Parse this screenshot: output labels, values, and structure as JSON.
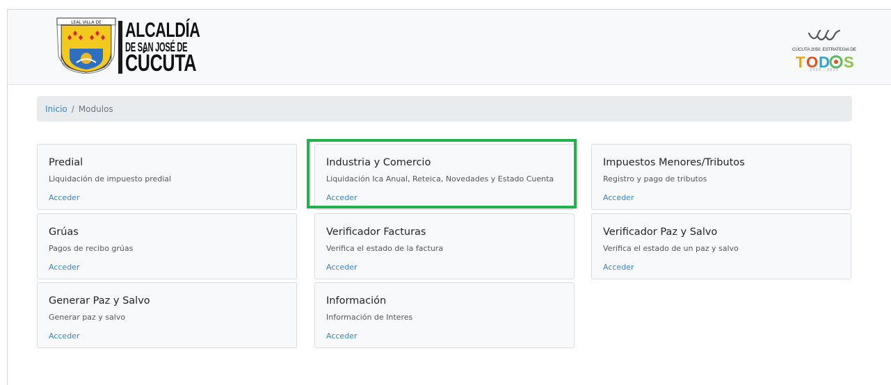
{
  "header": {
    "logo_left": {
      "line1": "ALCALDÍA",
      "line2": "DE SAN JOSÉ DE",
      "line3": "CÚCUTA",
      "shield_text": "LEAL VILLA DE SAN JOSE DE CUCUTA"
    },
    "logo_right": {
      "tagline": "CÚCUTA 2050, ESTRATEGIA DE",
      "brand": "TODOS",
      "years": "2020 - 2023"
    }
  },
  "breadcrumb": {
    "home": "Inicio",
    "separator": "/",
    "current": "Modulos"
  },
  "modules": [
    {
      "title": "Predial",
      "description": "Liquidación de impuesto predial",
      "link": "Acceder"
    },
    {
      "title": "Industria y Comercio",
      "description": "Liquidación Ica Anual, Reteica, Novedades y Estado Cuenta",
      "link": "Acceder"
    },
    {
      "title": "Impuestos Menores/Tributos",
      "description": "Registro y pago de tributos",
      "link": "Acceder"
    },
    {
      "title": "Grúas",
      "description": "Pagos de recibo grúas",
      "link": "Acceder"
    },
    {
      "title": "Verificador Facturas",
      "description": "Verifica el estado de la factura",
      "link": "Acceder"
    },
    {
      "title": "Verificador Paz y Salvo",
      "description": "Verifica el estado de un paz y salvo",
      "link": "Acceder"
    },
    {
      "title": "Generar Paz y Salvo",
      "description": "Generar paz y salvo",
      "link": "Acceder"
    },
    {
      "title": "Información",
      "description": "Información de Interes",
      "link": "Acceder"
    }
  ],
  "colors": {
    "link": "#3a82c4",
    "highlight": "#21b24b",
    "card_bg": "#f8f9fa",
    "breadcrumb_bg": "#e9ecef"
  },
  "highlighted_module": "Industria y Comercio"
}
